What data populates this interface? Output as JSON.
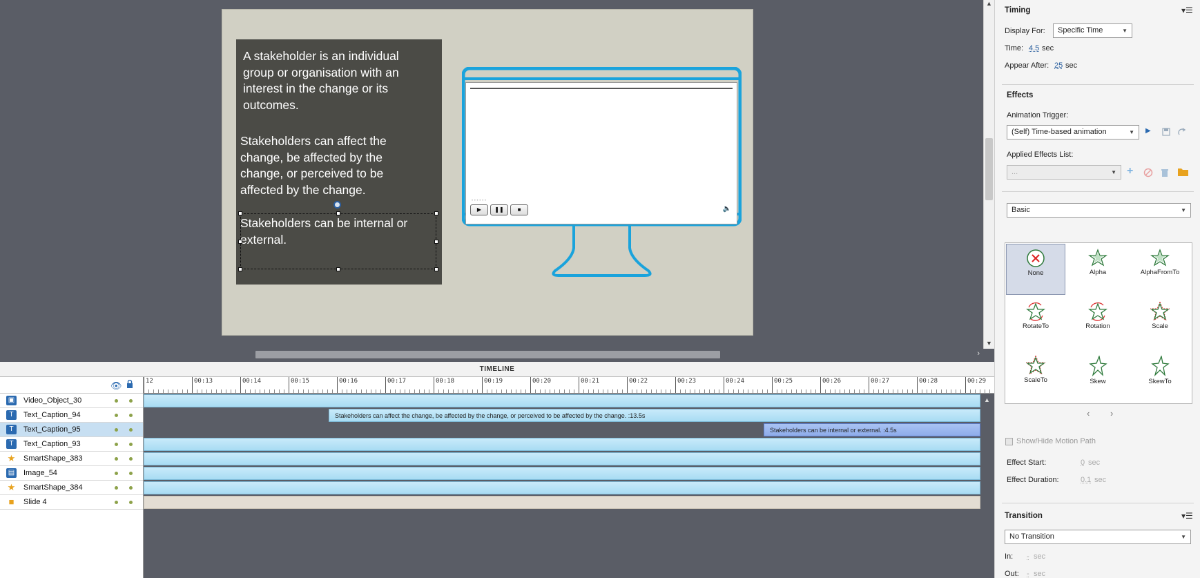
{
  "slide": {
    "text_para_1": "A stakeholder is an individual\ngroup or organisation with an\ninterest in the change or its\noutcomes.",
    "text_para_2": "Stakeholders can affect the\nchange, be affected by the\nchange, or perceived to be\naffected by the change.",
    "text_para_3": "Stakeholders can be internal or\nexternal.",
    "video_progress": "• • • • • •",
    "video_buttons": {
      "play": "▶",
      "pause": "❚❚",
      "stop": "■",
      "volume": "🔈"
    },
    "accent_color": "#1aa3dc"
  },
  "stage": {
    "hscroll_arrow": "›",
    "vscroll_up": "▲",
    "vscroll_down": "▼"
  },
  "timeline": {
    "title": "TIMELINE",
    "eye_icon": "👁",
    "layers": [
      {
        "name": "Video_Object_30",
        "icon": "video-icon",
        "color": "#2b6ab0"
      },
      {
        "name": "Text_Caption_94",
        "icon": "caption-icon",
        "color": "#2b6ab0"
      },
      {
        "name": "Text_Caption_95",
        "icon": "caption-icon",
        "color": "#2b6ab0",
        "selected": true
      },
      {
        "name": "Text_Caption_93",
        "icon": "caption-icon",
        "color": "#2b6ab0"
      },
      {
        "name": "SmartShape_383",
        "icon": "star-icon",
        "color": "#e8a21e"
      },
      {
        "name": "Image_54",
        "icon": "image-icon",
        "color": "#2b6ab0"
      },
      {
        "name": "SmartShape_384",
        "icon": "star-icon",
        "color": "#e8a21e"
      },
      {
        "name": "Slide 4",
        "icon": "slide-icon",
        "color": "#e8a21e"
      }
    ],
    "ruler_labels": [
      "12",
      "00:13",
      "00:14",
      "00:15",
      "00:16",
      "00:17",
      "00:18",
      "00:19",
      "00:20",
      "00:21",
      "00:22",
      "00:23",
      "00:24",
      "00:25",
      "00:26",
      "00:27",
      "00:28",
      "00:29"
    ],
    "bars": {
      "caption_94": "Stakeholders can affect the change, be affected by the change, or perceived to be affected by the change.  :13.5s",
      "caption_95": "Stakeholders can be internal or external.  :4.5s"
    },
    "scroll_up": "▲"
  },
  "panel": {
    "timing": {
      "title": "Timing",
      "display_for_label": "Display For:",
      "display_for_value": "Specific Time",
      "time_label": "Time:",
      "time_value": "4.5",
      "time_unit": "sec",
      "appear_after_label": "Appear After:",
      "appear_after_value": "25",
      "appear_after_unit": "sec"
    },
    "effects": {
      "title": "Effects",
      "trigger_label": "Animation Trigger:",
      "trigger_value": "(Self) Time-based animation",
      "applied_label": "Applied Effects List:",
      "applied_value": "...",
      "category": "Basic",
      "items": [
        "None",
        "Alpha",
        "AlphaFromTo",
        "RotateTo",
        "Rotation",
        "Scale",
        "ScaleTo",
        "Skew",
        "SkewTo"
      ],
      "prev": "‹",
      "next": "›",
      "motion_path_label": "Show/Hide Motion Path",
      "effect_start_label": "Effect Start:",
      "effect_start_value": "0",
      "effect_start_unit": "sec",
      "effect_duration_label": "Effect Duration:",
      "effect_duration_value": "0.1",
      "effect_duration_unit": "sec"
    },
    "transition": {
      "title": "Transition",
      "value": "No Transition",
      "in_label": "In:",
      "in_value": "-",
      "in_unit": "sec",
      "out_label": "Out:",
      "out_value": "-",
      "out_unit": "sec"
    },
    "dropdown_arrow": "▼",
    "menu_icon": "▾☰"
  }
}
